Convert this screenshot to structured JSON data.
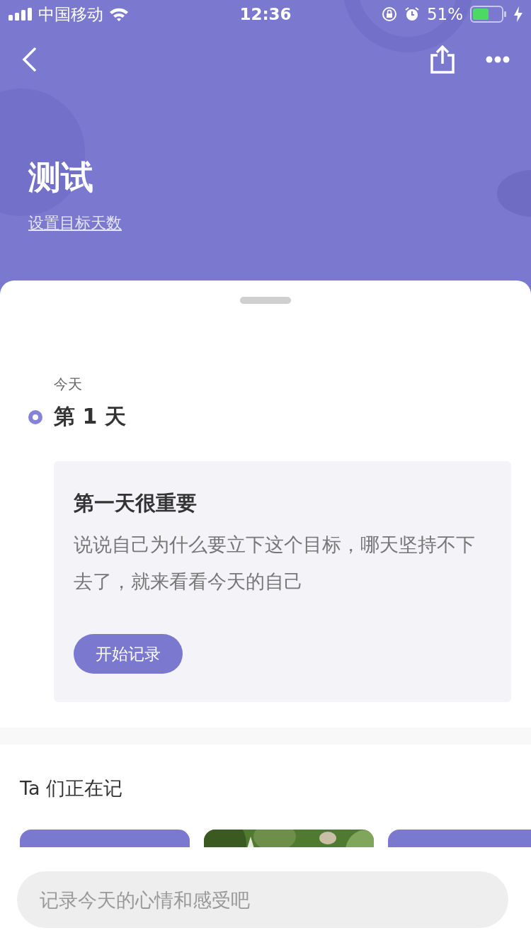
{
  "status_bar": {
    "carrier": "中国移动",
    "time": "12:36",
    "battery": "51%"
  },
  "header": {
    "title": "测试",
    "link": "设置目标天数"
  },
  "timeline": {
    "date_label": "今天",
    "day": "第 1 天",
    "current": true
  },
  "prompt_card": {
    "title": "第一天很重要",
    "text": "说说自己为什么要立下这个目标，哪天坚持不下去了，就来看看今天的自己",
    "button": "开始记录"
  },
  "others": {
    "heading": "Ta 们正在记",
    "cards": [
      {
        "kind": "purple"
      },
      {
        "kind": "picture"
      },
      {
        "kind": "purple"
      }
    ]
  },
  "composer": {
    "placeholder": "记录今天的心情和感受吧"
  }
}
